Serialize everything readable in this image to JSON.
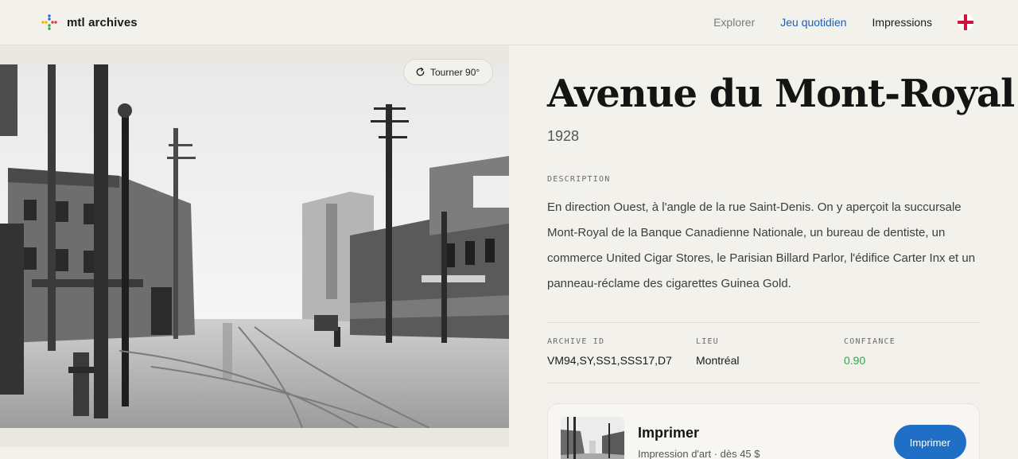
{
  "header": {
    "brand": "mtl archives",
    "nav": [
      {
        "label": "Explorer",
        "state": "muted"
      },
      {
        "label": "Jeu quotidien",
        "state": "active"
      },
      {
        "label": "Impressions",
        "state": "normal"
      }
    ],
    "language_icon": "england-flag-icon"
  },
  "photo": {
    "rotate_label": "Tourner 90°",
    "rotate_icon": "rotate-icon"
  },
  "record": {
    "title": "Avenue du Mont-Royal",
    "year": "1928",
    "description_label": "DESCRIPTION",
    "description": "En direction Ouest, à l'angle de la rue Saint-Denis. On y aperçoit la succursale Mont-Royal de la Banque Canadienne Nationale, un bureau de dentiste, un commerce United Cigar Stores, le Parisian Billard Parlor, l'édifice Carter Inx et un panneau-réclame des cigarettes Guinea Gold.",
    "meta": {
      "archive_id_label": "ARCHIVE ID",
      "archive_id": "VM94,SY,SS1,SSS17,D7",
      "place_label": "LIEU",
      "place": "Montréal",
      "confidence_label": "CONFIANCE",
      "confidence": "0.90"
    }
  },
  "print": {
    "title": "Imprimer",
    "subtitle": "Impression d'art · dès 45 $",
    "button": "Imprimer"
  },
  "colors": {
    "accent": "#1f6fc6",
    "nav_active": "#1f5fb0",
    "confidence": "#2fa84f",
    "background": "#f3f1ec"
  }
}
